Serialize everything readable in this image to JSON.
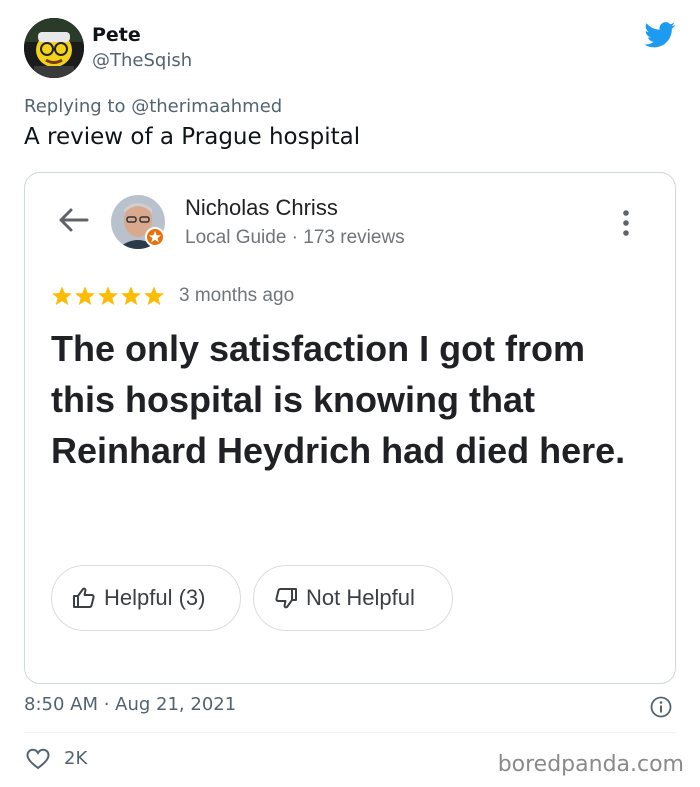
{
  "tweet": {
    "author_name": "Pete",
    "author_handle": "@TheSqish",
    "replying_to_prefix": "Replying to",
    "replying_to_handle": "@therimaahmed",
    "text": "A review of a Prague hospital",
    "timestamp": "8:50 AM · Aug 21, 2021",
    "likes": "2K"
  },
  "review_card": {
    "reviewer_name": "Nicholas Chriss",
    "reviewer_meta": "Local Guide · 173 reviews",
    "rating": 5,
    "rating_max": 5,
    "time_ago": "3 months ago",
    "review_text": "The only satisfaction I got from this hospital is knowing that Reinhard Heydrich had died here.",
    "helpful_label": "Helpful (3)",
    "not_helpful_label": "Not Helpful"
  },
  "watermark": "boredpanda.com",
  "colors": {
    "twitter_blue": "#1d9bf0",
    "star_gold": "#fbbc04",
    "local_guide_orange": "#e8710a",
    "muted_text": "#536471"
  },
  "icons": [
    "twitter-bird-icon",
    "back-arrow-icon",
    "local-guide-badge-icon",
    "more-options-icon",
    "star-icon",
    "thumbs-up-icon",
    "thumbs-down-icon",
    "info-icon",
    "heart-icon"
  ]
}
